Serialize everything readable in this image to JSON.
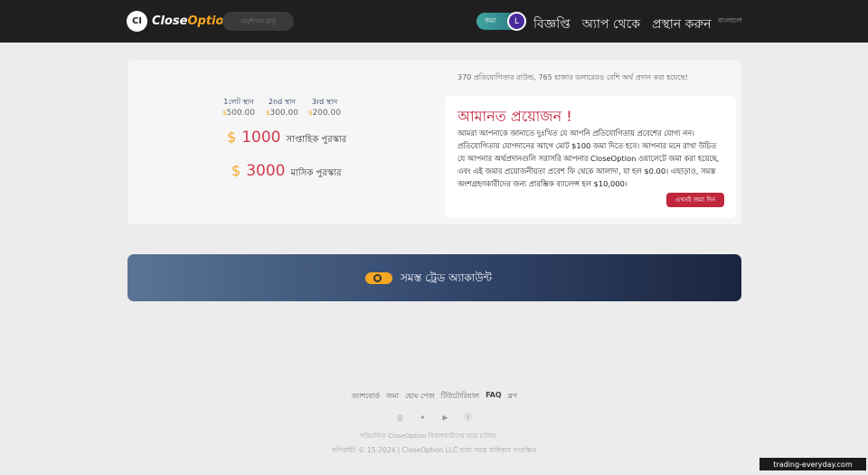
{
  "header": {
    "logo_mark": "CI",
    "logo_text_a": "Close",
    "logo_text_b": "Option",
    "tour_button": "অনুশীলন চালু",
    "deposit_pill": "জমা",
    "avatar_initial": "L",
    "nav": [
      "বিজ্ঞপ্তি",
      "অ্যাপ থেকে",
      "প্রস্থান করুন"
    ],
    "nav_extra": "বাংলাদেশ"
  },
  "prizes": {
    "places": [
      {
        "name": "1লেট স্থান",
        "currency": "$",
        "amount": "500.00"
      },
      {
        "name": "2nd স্থান",
        "currency": "$",
        "amount": "300.00"
      },
      {
        "name": "3rd স্থান",
        "currency": "$",
        "amount": "200.00"
      }
    ],
    "weekly": {
      "currency": "$",
      "amount": "1000",
      "label": "সাপ্তাহিক পুরস্কার"
    },
    "monthly": {
      "currency": "$",
      "amount": "3000",
      "label": "মাসিক পুরস্কার"
    }
  },
  "rounds_text": "370 প্রতিযোগিতার রাউন্ড, 765 হাজার ডলারেরও বেশি অর্থ প্রদান করা হয়েছে!",
  "alert": {
    "title": "আমানত প্রয়োজন !",
    "body": "আমরা আপনাকে জানাতে দুঃখিত যে আপনি প্রতিযোগিতায় প্রবেশের যোগ্য নন। প্রতিযোগিতায় যোগদানের আগে মোট $100 জমা দিতে হবে। আপনার মনে রাখা উচিত যে আপনার অর্থপ্রদানগুলি সরাসরি আপনার CloseOption ওয়ালেটে জমা করা হয়েছে, এবং এই জমার প্রয়োজনীয়তা প্রবেশ ফি থেকে আলাদা, যা হল $0.00। এছাড়াও, সমস্ত অংশগ্রহণকারীদের জন্য প্রারম্ভিক ব্যালেন্স হল $10,000।",
    "button": "এখনই জমা দিন"
  },
  "banner": {
    "label": "সমস্ত ট্রেড অ্যাকাউন্ট"
  },
  "footer": {
    "links": [
      "ড্যাশবোর্ড",
      "জমা",
      "হোম পেজ",
      "টিউটোরিয়াল",
      "FAQ",
      "ব্লগ"
    ],
    "social": [
      "instagram-icon",
      "twitter-icon",
      "youtube-icon",
      "skype-icon"
    ],
    "powered": "পরিচালিত CloseOption বিকাশকারীদের দ্বারা চালিত",
    "copyright": "কপিরাইট © 15-2024 | CloseOption LLC দ্বারা সমস্ত অধিকার সংরক্ষিত"
  },
  "watermark": "trading-everyday.com"
}
